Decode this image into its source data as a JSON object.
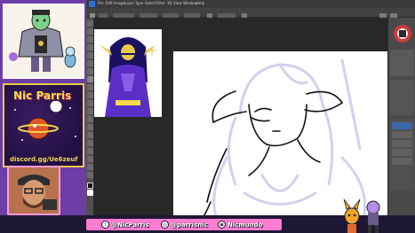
{
  "overlay": {
    "streamer_name": "Nic Parris",
    "discord": "discord.gg/Ue6zeuf"
  },
  "photoshop": {
    "menu": [
      "File",
      "Edit",
      "Image",
      "Layer",
      "Type",
      "Select",
      "Filter",
      "3D",
      "View",
      "Window",
      "Help"
    ]
  },
  "socials": [
    {
      "icon": "twitter-icon",
      "handle": "@NicParris"
    },
    {
      "icon": "instagram-icon",
      "handle": "@parrisnic"
    },
    {
      "icon": "twitch-icon",
      "handle": "Nicmundo"
    }
  ],
  "colors": {
    "overlay_purple": "#6d3fa6",
    "social_pink": "#ff7dd0",
    "sketch_lavender": "#d5cfee",
    "brand_yellow": "#f5d94a"
  }
}
